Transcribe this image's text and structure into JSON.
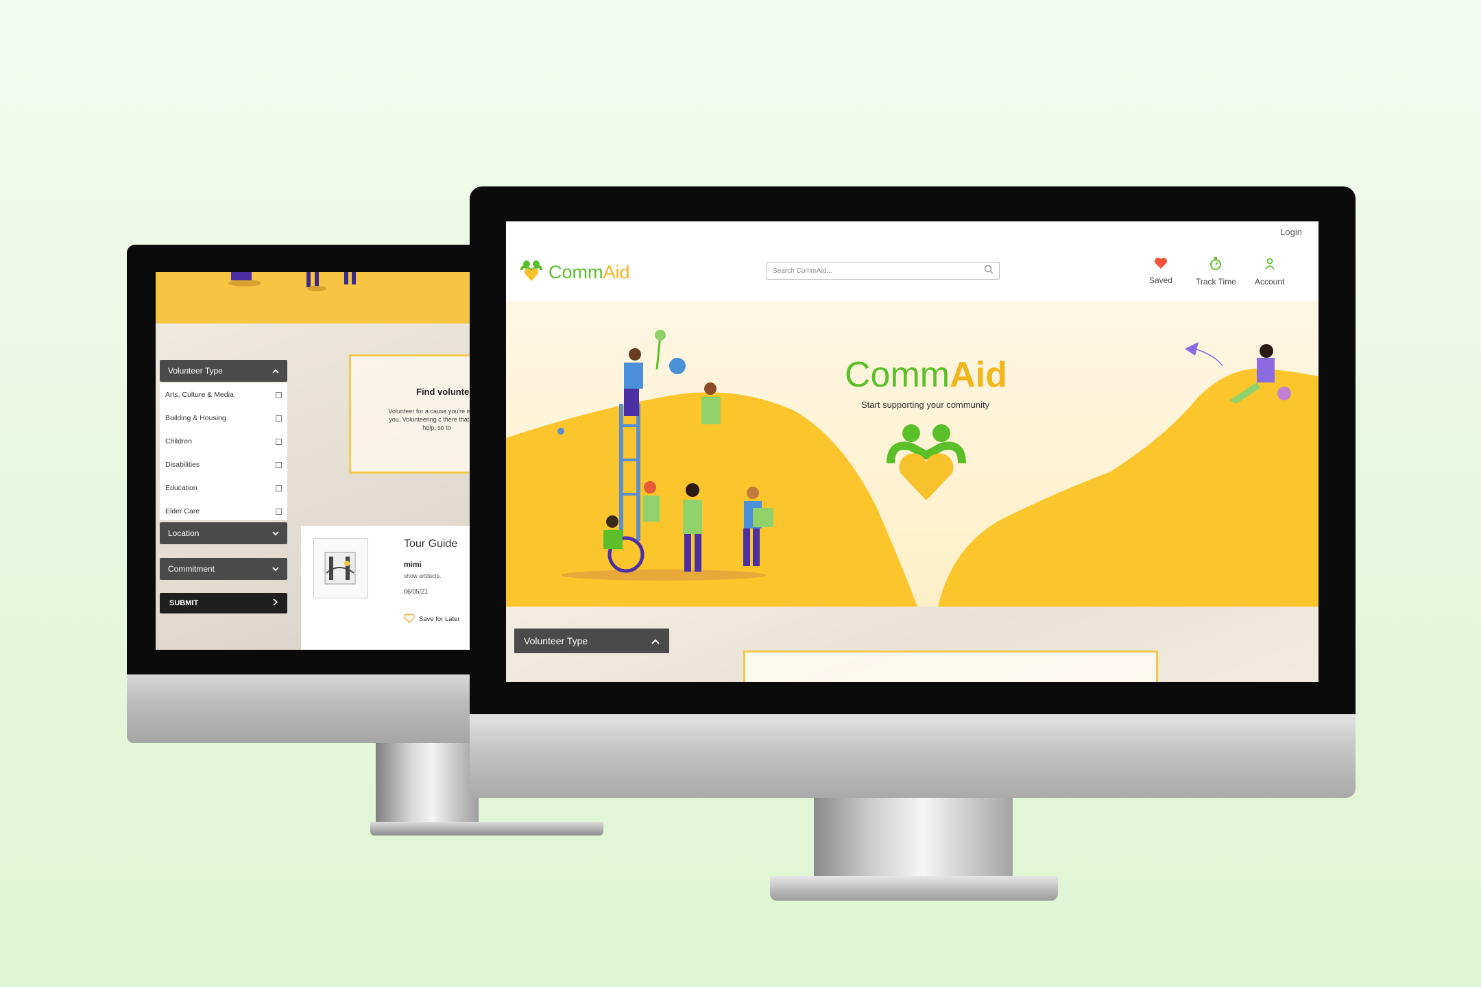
{
  "colors": {
    "brand_green": "#5bbf2a",
    "brand_yellow": "#f7c22c",
    "hero_yellow": "#fbc52b",
    "dark_panel": "#4a4a4a",
    "heart_red": "#f0523a"
  },
  "back_screen": {
    "sidebar": {
      "volunteer_type_label": "Volunteer Type",
      "categories": [
        {
          "label": "Arts, Culture & Media"
        },
        {
          "label": "Building & Housing"
        },
        {
          "label": "Children"
        },
        {
          "label": "Disabilities"
        },
        {
          "label": "Education"
        },
        {
          "label": "Elder Care"
        }
      ],
      "location_label": "Location",
      "commitment_label": "Commitment",
      "submit_label": "SUBMIT"
    },
    "find_card": {
      "title": "Find volunte",
      "text": "Volunteer for a cause you're is near you. Volunteering c there that need help, so to"
    },
    "opportunity": {
      "title": "Tour Guide",
      "user": "mimi",
      "description": "show artifacts.",
      "date": "06/05/21",
      "save_label": "Save for Later"
    }
  },
  "front_screen": {
    "login_label": "Login",
    "logo": {
      "part1": "Comm",
      "part2": "Aid"
    },
    "search": {
      "placeholder": "Search CommAid..."
    },
    "nav": [
      {
        "label": "Saved",
        "icon": "heart-icon"
      },
      {
        "label": "Track Time",
        "icon": "stopwatch-icon"
      },
      {
        "label": "Account",
        "icon": "person-icon"
      }
    ],
    "hero": {
      "title_part1": "Comm",
      "title_part2": "Aid",
      "subtitle": "Start supporting your community"
    },
    "filter": {
      "volunteer_type_label": "Volunteer Type"
    }
  }
}
